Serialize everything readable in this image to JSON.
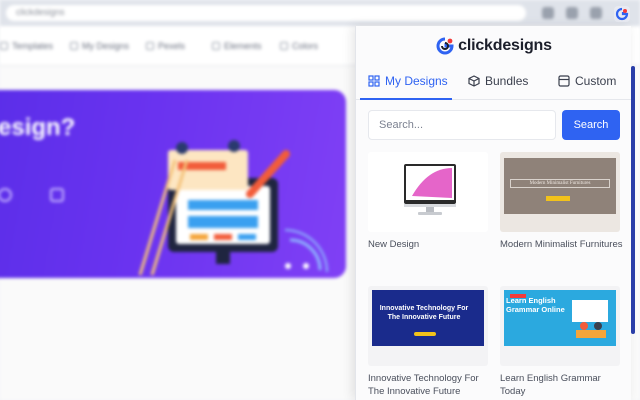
{
  "background_page": {
    "address_text": "clickdesigns",
    "nav": [
      "Templates",
      "My Designs",
      "Pexels",
      "Elements",
      "Colors"
    ],
    "banner_title": "esign?"
  },
  "popup": {
    "brand": "clickdesigns",
    "tabs": [
      {
        "label": "My Designs",
        "icon": "grid-icon",
        "active": true
      },
      {
        "label": "Bundles",
        "icon": "cube-icon",
        "active": false
      },
      {
        "label": "Custom",
        "icon": "image-icon",
        "active": false
      }
    ],
    "search": {
      "placeholder": "Search...",
      "value": "",
      "button_label": "Search"
    },
    "designs": [
      {
        "label": "New Design"
      },
      {
        "label": "Modern Minimalist Furnitures",
        "thumb_title": "Modern Minimalist Furnitures"
      },
      {
        "label": "Innovative Technology For The Innovative Future",
        "thumb_title": "Innovative Technology For The Innovative Future"
      },
      {
        "label": "Learn English Grammar Today",
        "thumb_title": "Learn English Grammar Online"
      }
    ]
  },
  "colors": {
    "accent": "#2f63f2",
    "banner": "#6a33f0",
    "navy": "#1a2b8c"
  }
}
